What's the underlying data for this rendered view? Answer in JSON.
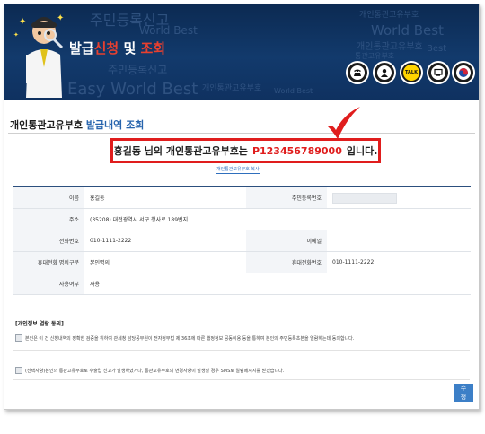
{
  "banner": {
    "title_part1": "발급",
    "title_part2": "신청",
    "title_part3": " 및 ",
    "title_part4": "조회",
    "watermarks": [
      "주민등록신고",
      "개인통관고유부호",
      "World Best",
      "개인통관고유부호",
      "World Best",
      "주민등록신고",
      "Easy World Best",
      "개인통관고유부호",
      "Best",
      "World Best",
      "통관고유부호"
    ],
    "icons": [
      "telephone-icon",
      "person-icon",
      "talk-icon",
      "screen-icon",
      "taegeuk-icon"
    ],
    "talk_label": "TALK"
  },
  "page": {
    "heading_main": "개인통관고유부호",
    "heading_highlight": "발급내역 조회",
    "result_prefix": "홍길동 님의 개인통관고유부호는",
    "result_code": "P123456789000",
    "result_suffix": "입니다.",
    "copy_button": "개인통관고유부호 복사"
  },
  "info_table": {
    "rows": [
      {
        "l1": "이름",
        "v1": "홍길동",
        "l2": "주민등록번호",
        "v2": ""
      },
      {
        "l1": "주소",
        "v1": "(35208) 대전광역시 서구 청사로 189번지",
        "l2": "",
        "v2": ""
      },
      {
        "l1": "전화번호",
        "v1": "010-1111-2222",
        "l2": "이메일",
        "v2": ""
      },
      {
        "l1": "휴대전화 명의구분",
        "v1": "본인명의",
        "l2": "휴대전화번호",
        "v2": "010-1111-2222"
      },
      {
        "l1": "사용여부",
        "v1": "사용",
        "l2": "",
        "v2": ""
      }
    ]
  },
  "consent": {
    "title": "[개인정보 열람 동의]",
    "item1": "본인은 이 건 신청내역의 정확한 검증을 위하여 관세청 담당공무원이 전자정부법 제 36조에 따른 행정정보 공동이용 등을 통하여 본인의 주민등록초본을 열람하는데 동의합니다.",
    "item2": "(선택사항)본인의 통관고유부호로 수출입 신고가 발생하였거나, 통관고유부호의 변경사항이 발생할 경우 SMS로 알림메시지를 받겠습니다."
  },
  "actions": {
    "edit_label": "수정"
  },
  "colors": {
    "banner": "#123a6c",
    "accent_red": "#e01d1d",
    "link_blue": "#2764ad",
    "button_blue": "#3c7fc7"
  }
}
